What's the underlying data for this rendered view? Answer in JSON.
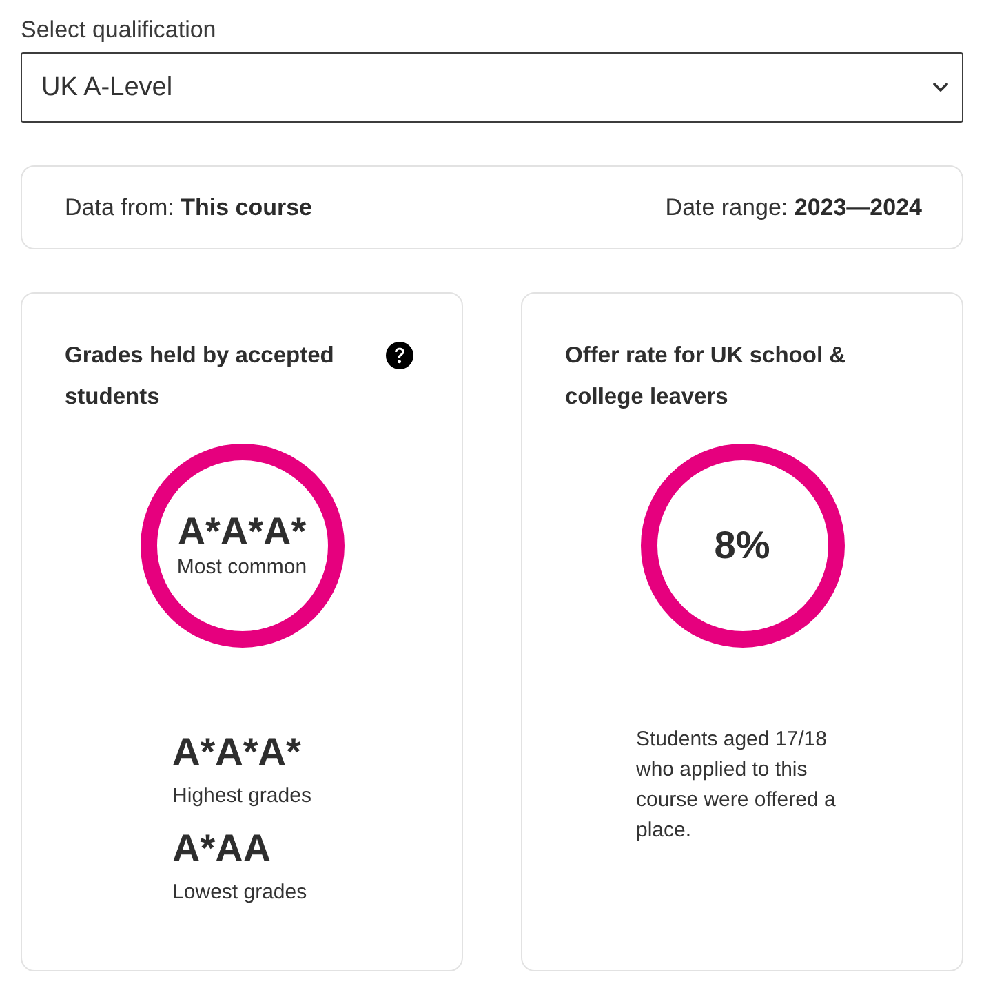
{
  "qualification_select": {
    "label": "Select qualification",
    "value": "UK A-Level"
  },
  "data_info": {
    "source": "Data from: **This course**",
    "range": "Date range: **2023—2024**"
  },
  "cards": [
    {
      "kind": "grades",
      "title": "Grades held by accepted students",
      "help": true,
      "ring": {
        "value": "A*A*A*",
        "caption": "Most common"
      },
      "stats": [
        {
          "value": "A*A*A*",
          "label": "Highest grades"
        },
        {
          "value": "A*AA",
          "label": "Lowest grades"
        }
      ]
    },
    {
      "kind": "rate",
      "title": "Offer rate for UK school & college leavers",
      "help": false,
      "ring": {
        "value": "8%"
      },
      "note": "Students aged 17/18 who applied to this course were offered a place."
    }
  ]
}
